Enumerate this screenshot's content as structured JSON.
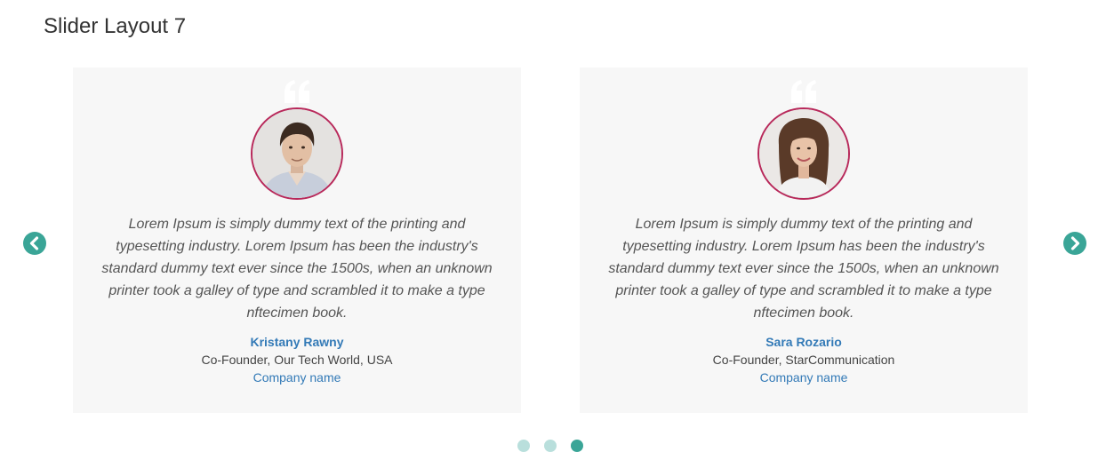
{
  "page": {
    "title": "Slider Layout 7"
  },
  "colors": {
    "accent": "#3aa597",
    "accent_light": "#b9dfdc",
    "avatar_border": "#b8285a",
    "card_bg": "#f7f7f7",
    "link": "#337ab7"
  },
  "slider": {
    "prev_icon": "chevron-left-circle-icon",
    "next_icon": "chevron-right-circle-icon",
    "active_dot": 3,
    "dot_count": 3,
    "cards": [
      {
        "quote": "Lorem Ipsum is simply dummy text of the printing and typesetting industry. Lorem Ipsum has been the industry's standard dummy text ever since the 1500s, when an unknown printer took a galley of type and scrambled it to make a type nftecimen book.",
        "name": "Kristany Rawny",
        "role": "Co-Founder, Our Tech World, USA",
        "company": "Company name",
        "avatar": "man-portrait-avatar"
      },
      {
        "quote": "Lorem Ipsum is simply dummy text of the printing and typesetting industry. Lorem Ipsum has been the industry's standard dummy text ever since the 1500s, when an unknown printer took a galley of type and scrambled it to make a type nftecimen book.",
        "name": "Sara Rozario",
        "role": "Co-Founder, StarCommunication",
        "company": "Company name",
        "avatar": "woman-portrait-avatar"
      }
    ]
  }
}
